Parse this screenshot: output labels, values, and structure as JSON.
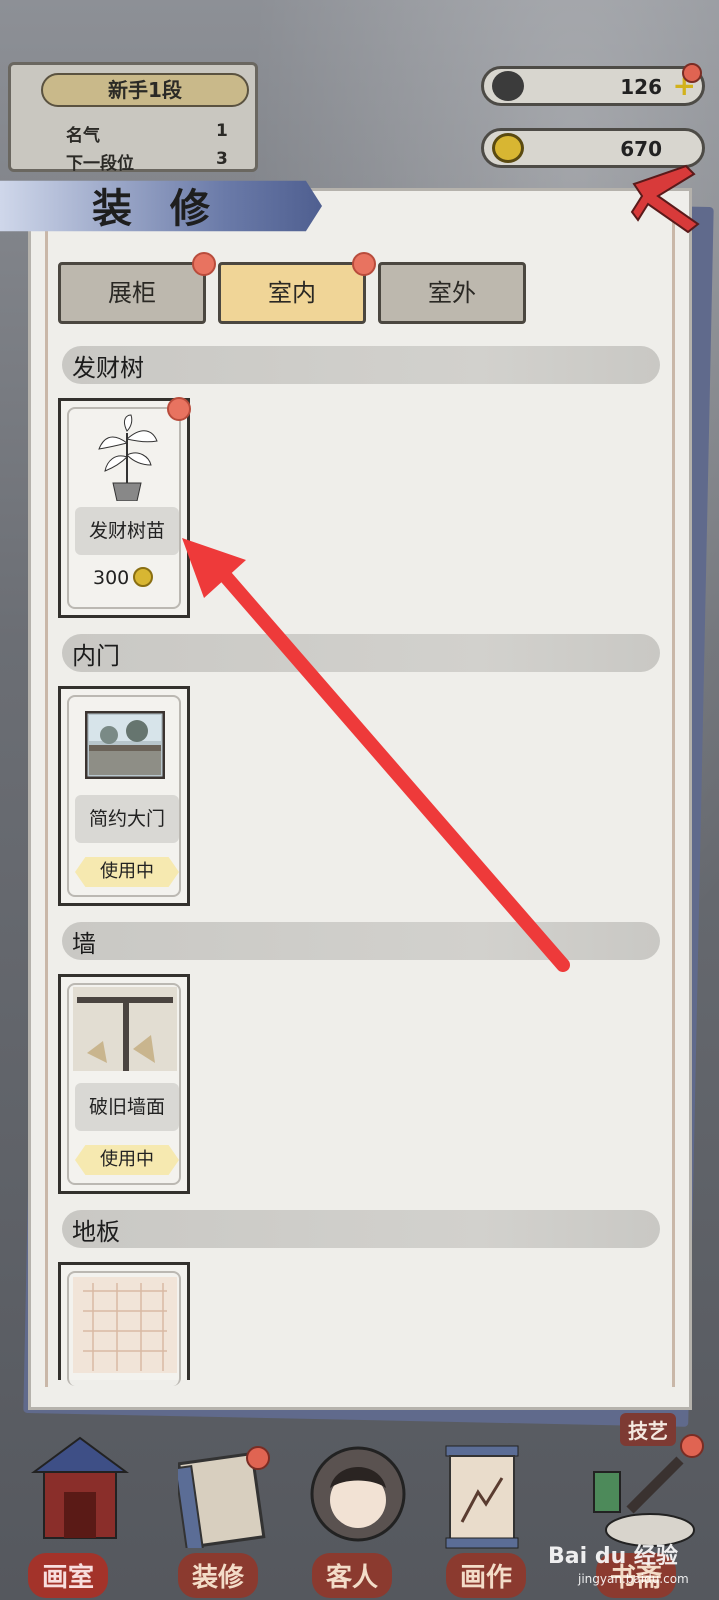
{
  "status": {
    "rank_title": "新手1段",
    "fame_label": "名气",
    "fame_value": "1",
    "next_rank_label": "下一段位",
    "next_rank_value": "3"
  },
  "resources": {
    "ink_value": "126",
    "coin_value": "670"
  },
  "panel": {
    "title": "装 修",
    "tabs": [
      {
        "label": "展柜"
      },
      {
        "label": "室内"
      },
      {
        "label": "室外"
      }
    ],
    "active_tab": "室内",
    "sections": [
      {
        "title": "发财树",
        "item_name": "发财树苗",
        "price": "300"
      },
      {
        "title": "内门",
        "item_name": "简约大门",
        "status": "使用中"
      },
      {
        "title": "墙",
        "item_name": "破旧墙面",
        "status": "使用中"
      },
      {
        "title": "地板"
      }
    ]
  },
  "bottom_nav": {
    "items": [
      {
        "label": "画室"
      },
      {
        "label": "装修"
      },
      {
        "label": "客人"
      },
      {
        "label": "画作"
      },
      {
        "label": "书斋"
      }
    ],
    "skill_label": "技艺"
  },
  "watermark": {
    "text": "Bai du 经验",
    "sub": "jingyan.baidu.com"
  },
  "colors": {
    "active_tab": "#f0d597",
    "inactive_tab": "#bdb8ae",
    "badge_red": "#e87360",
    "banner_blue": "#4f5f90",
    "annotation_arrow": "#ee3a3a"
  }
}
